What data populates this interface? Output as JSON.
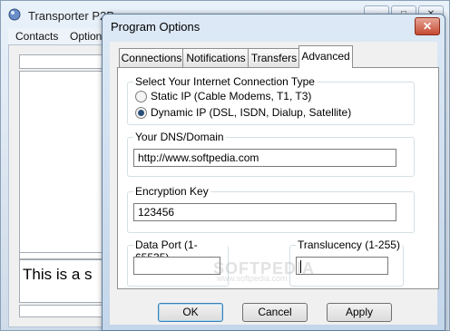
{
  "main_window": {
    "title": "Transporter P2P",
    "menu": [
      "Contacts",
      "Options"
    ],
    "chat_text": "This is a s"
  },
  "dialog": {
    "title": "Program Options",
    "close_label": "✕",
    "tabs": [
      {
        "label": "Connections"
      },
      {
        "label": "Notifications"
      },
      {
        "label": "Transfers"
      },
      {
        "label": "Advanced"
      }
    ],
    "active_tab": "Advanced",
    "connection_group": {
      "label": "Select Your Internet Connection Type",
      "options": [
        {
          "label": "Static IP (Cable Modems, T1, T3)",
          "selected": false
        },
        {
          "label": "Dynamic IP (DSL, ISDN, Dialup, Satellite)",
          "selected": true
        }
      ]
    },
    "dns": {
      "label": "Your DNS/Domain",
      "value": "http://www.softpedia.com"
    },
    "encryption": {
      "label": "Encryption Key",
      "value": "123456"
    },
    "data_port": {
      "label": "Data Port (1-65535)",
      "value": ""
    },
    "translucency": {
      "label": "Translucency (1-255)",
      "value": ""
    },
    "buttons": {
      "ok": "OK",
      "cancel": "Cancel",
      "apply": "Apply"
    }
  },
  "watermark": {
    "text": "SOFTPEDIA",
    "sub": "www.softpedia.com"
  }
}
